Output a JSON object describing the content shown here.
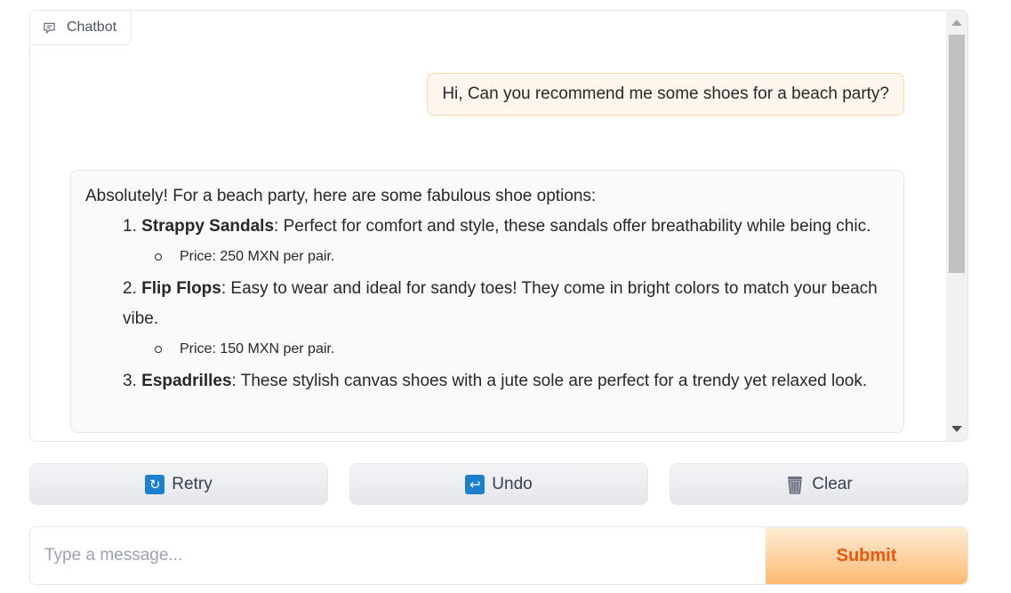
{
  "chatbot": {
    "label": "Chatbot",
    "user_message": "Hi, Can you recommend me some shoes for a beach party?",
    "bot_message": {
      "intro": "Absolutely! For a beach party, here are some fabulous shoe options:",
      "items": [
        {
          "number": "1.",
          "name": "Strappy Sandals",
          "desc": ": Perfect for comfort and style, these sandals offer breathability while being chic.",
          "price": "Price: 250 MXN per pair."
        },
        {
          "number": "2.",
          "name": "Flip Flops",
          "desc": ": Easy to wear and ideal for sandy toes! They come in bright colors to match your beach vibe.",
          "price": "Price: 150 MXN per pair."
        },
        {
          "number": "3.",
          "name": "Espadrilles",
          "desc": ": These stylish canvas shoes with a jute sole are perfect for a trendy yet relaxed look.",
          "price": ""
        }
      ]
    }
  },
  "buttons": {
    "retry": "Retry",
    "undo": "Undo",
    "clear": "Clear"
  },
  "input": {
    "placeholder": "Type a message...",
    "value": "",
    "submit_label": "Submit"
  },
  "colors": {
    "accent": "#ea580c",
    "user_bubble": "#fff7ed",
    "bot_bubble": "#f9fafb"
  },
  "icons": {
    "chatbot_label": "chat-bubble-icon",
    "retry": "refresh-icon",
    "undo": "return-icon",
    "clear": "wastebasket-icon"
  }
}
